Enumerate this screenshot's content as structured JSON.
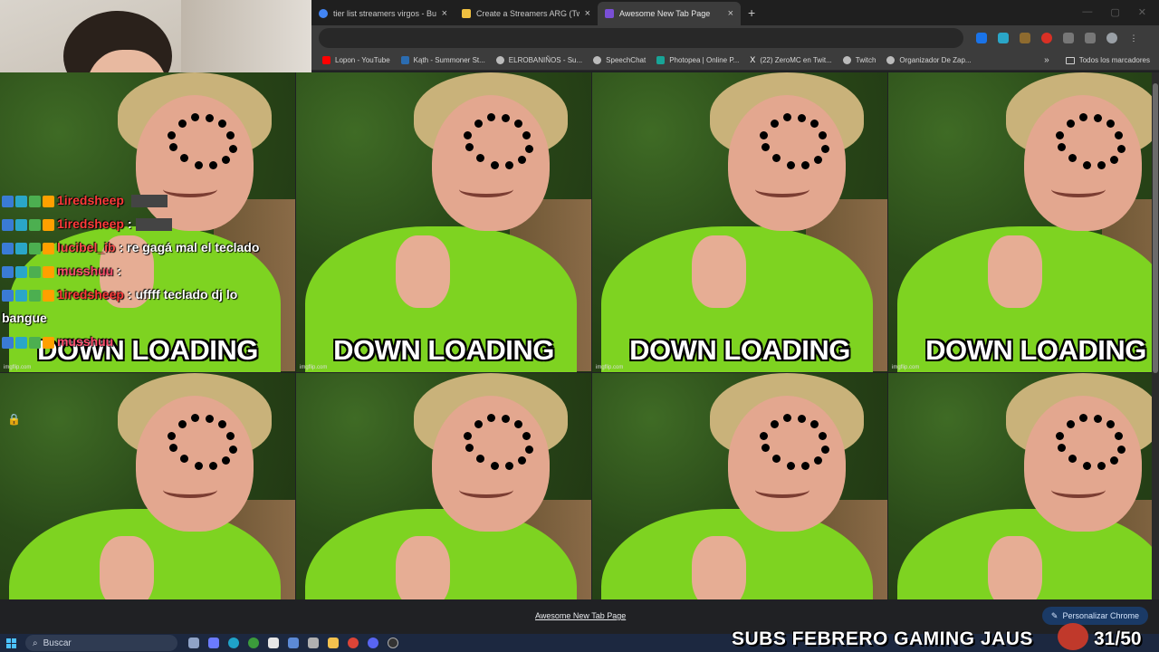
{
  "browser": {
    "tabs": [
      {
        "label": "tier list streamers virgos - Busca",
        "favicon_color": "#4285f4",
        "active": false
      },
      {
        "label": "Create a Streamers ARG (Twitch",
        "favicon_color": "#222222",
        "active": false
      },
      {
        "label": "Awesome New Tab Page",
        "favicon_color": "#7a4fd6",
        "active": true
      }
    ],
    "new_tab_symbol": "+",
    "close_symbol": "×",
    "bookmarks": [
      {
        "label": "Lopon - YouTube",
        "color": "#ff0000"
      },
      {
        "label": "Kąth - Summoner St...",
        "color": "#2b6cb0"
      },
      {
        "label": "ELROBANIÑOS - Su...",
        "color": "#bbbbbb"
      },
      {
        "label": "SpeechChat",
        "color": "#bbbbbb"
      },
      {
        "label": "Photopea | Online P...",
        "color": "#18a497"
      },
      {
        "label": "(22) ZeroMC en Twit...",
        "color": "#ffffff"
      },
      {
        "label": "Twitch",
        "color": "#bbbbbb"
      },
      {
        "label": "Organizador De Zap...",
        "color": "#bbbbbb"
      }
    ],
    "bookmarks_more": "»",
    "all_bookmarks_label": "Todos los marcadores"
  },
  "page": {
    "meme_caption": "DOWN LOADING",
    "watermark": "imgflip.com",
    "footer_link": "Awesome New Tab Page",
    "customize_button": "Personalizar Chrome"
  },
  "chat": [
    {
      "user": "1iredsheep",
      "user_color": "#ff3b3b",
      "text": ""
    },
    {
      "user": "1iredsheep",
      "user_color": "#ff3b3b",
      "text": ":"
    },
    {
      "user": "lucibel_ib",
      "user_color": "#ff4f4f",
      "text": ": re gagá mal el teclado"
    },
    {
      "user": "musshuu",
      "user_color": "#ff4f6d",
      "text": ":"
    },
    {
      "user": "1iredsheep",
      "user_color": "#ff3b3b",
      "text": ": uffff teclado dj lo bangue"
    },
    {
      "user": "musshuu",
      "user_color": "#ff4f6d",
      "text": ""
    }
  ],
  "taskbar": {
    "search_placeholder": "Buscar"
  },
  "overlay": {
    "subs_text": "SUBS FEBRERO GAMING JAUS",
    "subs_count": "31/50"
  }
}
